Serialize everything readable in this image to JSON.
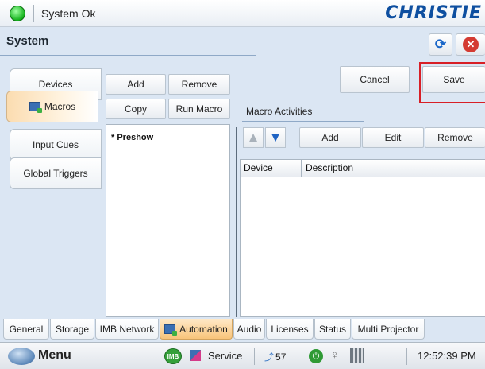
{
  "status": {
    "text": "System Ok",
    "brand": "CHRISTIE"
  },
  "header": {
    "title": "System"
  },
  "left_tabs": [
    {
      "label": "Devices"
    },
    {
      "label": "Macros",
      "active": true
    },
    {
      "label": "Input Cues"
    },
    {
      "label": "Global Triggers"
    }
  ],
  "macro_panel": {
    "add_label": "Add",
    "remove_label": "Remove",
    "copy_label": "Copy",
    "run_label": "Run Macro",
    "items": [
      "* Preshow"
    ]
  },
  "actions": {
    "cancel_label": "Cancel",
    "save_label": "Save"
  },
  "activities": {
    "section_label": "Macro Activities",
    "add_label": "Add",
    "edit_label": "Edit",
    "remove_label": "Remove",
    "columns": [
      "Device",
      "Description"
    ]
  },
  "bottom_tabs": [
    {
      "label": "General"
    },
    {
      "label": "Storage"
    },
    {
      "label": "IMB Network"
    },
    {
      "label": "Automation",
      "active": true
    },
    {
      "label": "Audio"
    },
    {
      "label": "Licenses"
    },
    {
      "label": "Status"
    },
    {
      "label": "Multi Projector"
    }
  ],
  "taskbar": {
    "menu_label": "Menu",
    "imb_label": "IMB",
    "service_label": "Service",
    "temperature": "57",
    "time": "12:52:39 PM"
  },
  "colors": {
    "accent": "#0e4fa0",
    "highlight": "#d81f26",
    "active_tab": "#f8c47a",
    "ok": "#15b31d"
  }
}
